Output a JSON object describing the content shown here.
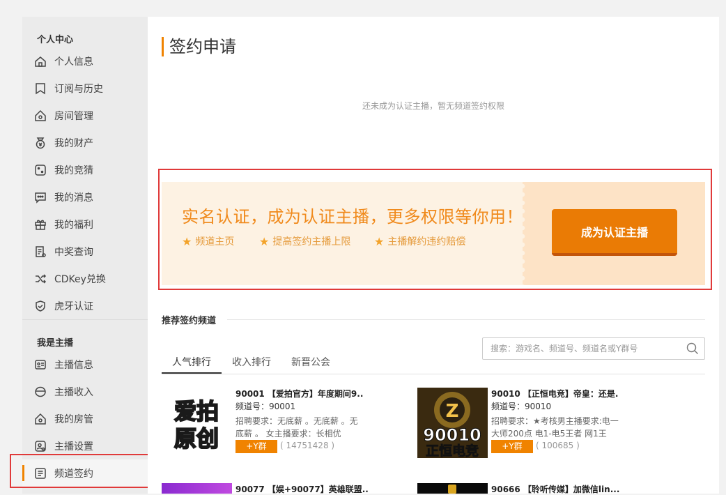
{
  "sidebar": {
    "personal_title": "个人中心",
    "personal_items": [
      {
        "label": "个人信息",
        "icon": "home-icon"
      },
      {
        "label": "订阅与历史",
        "icon": "bookmark-icon"
      },
      {
        "label": "房间管理",
        "icon": "room-icon"
      },
      {
        "label": "我的财产",
        "icon": "money-bag-icon"
      },
      {
        "label": "我的竞猜",
        "icon": "dice-icon"
      },
      {
        "label": "我的消息",
        "icon": "message-icon"
      },
      {
        "label": "我的福利",
        "icon": "gift-icon"
      },
      {
        "label": "中奖查询",
        "icon": "receipt-icon"
      },
      {
        "label": "CDKey兑换",
        "icon": "shuffle-icon"
      },
      {
        "label": "虎牙认证",
        "icon": "shield-check-icon"
      }
    ],
    "anchor_title": "我是主播",
    "anchor_items": [
      {
        "label": "主播信息",
        "icon": "id-card-icon"
      },
      {
        "label": "主播收入",
        "icon": "coin-icon"
      },
      {
        "label": "我的房管",
        "icon": "room-icon"
      },
      {
        "label": "主播设置",
        "icon": "user-gear-icon"
      },
      {
        "label": "频道签约",
        "icon": "document-icon"
      }
    ]
  },
  "main": {
    "title": "签约申请",
    "notice": "还未成为认证主播，暂无频道签约权限",
    "banner": {
      "headline": "实名认证，成为认证主播，更多权限等你用！",
      "features": [
        "频道主页",
        "提高签约主播上限",
        "主播解约违约赔偿"
      ],
      "cta": "成为认证主播"
    },
    "recommend_title": "推荐签约频道",
    "tabs": [
      "人气排行",
      "收入排行",
      "新晋公会"
    ],
    "search_placeholder": "搜索：游戏名、频道号、频道名或Y群号",
    "channels": [
      {
        "name": "90001 【爱拍官方】年度期间9..",
        "number": "频道号：90001",
        "req": "招聘要求：无底薪 。无底薪 。无底薪 。 女主播要求：长相优",
        "ybtn": "+Y群",
        "fans": "( 14751428 )",
        "logo_text": [
          "爱拍",
          "原创"
        ]
      },
      {
        "name": "90010 【正恒电竞】帝皇：还是.",
        "number": "频道号：90010",
        "req": "招聘要求：★考核男主播要求:电一大师200点 电1-电5王者 网1王",
        "ybtn": "+Y群",
        "fans": "( 100685 )",
        "logo_text": [
          "90010",
          "正恒电竞"
        ]
      },
      {
        "name": "90077 【娱+90077】英雄联盟..",
        "number": "",
        "req": "",
        "ybtn": "",
        "fans": ""
      },
      {
        "name": "90666 【聆听传媒】加微信lin...",
        "number": "",
        "req": "",
        "ybtn": "",
        "fans": ""
      }
    ]
  },
  "colors": {
    "accent": "#f08300",
    "banner_text": "#f08a1c",
    "cta": "#ea7b05",
    "highlight_box": "#e03a3a"
  }
}
